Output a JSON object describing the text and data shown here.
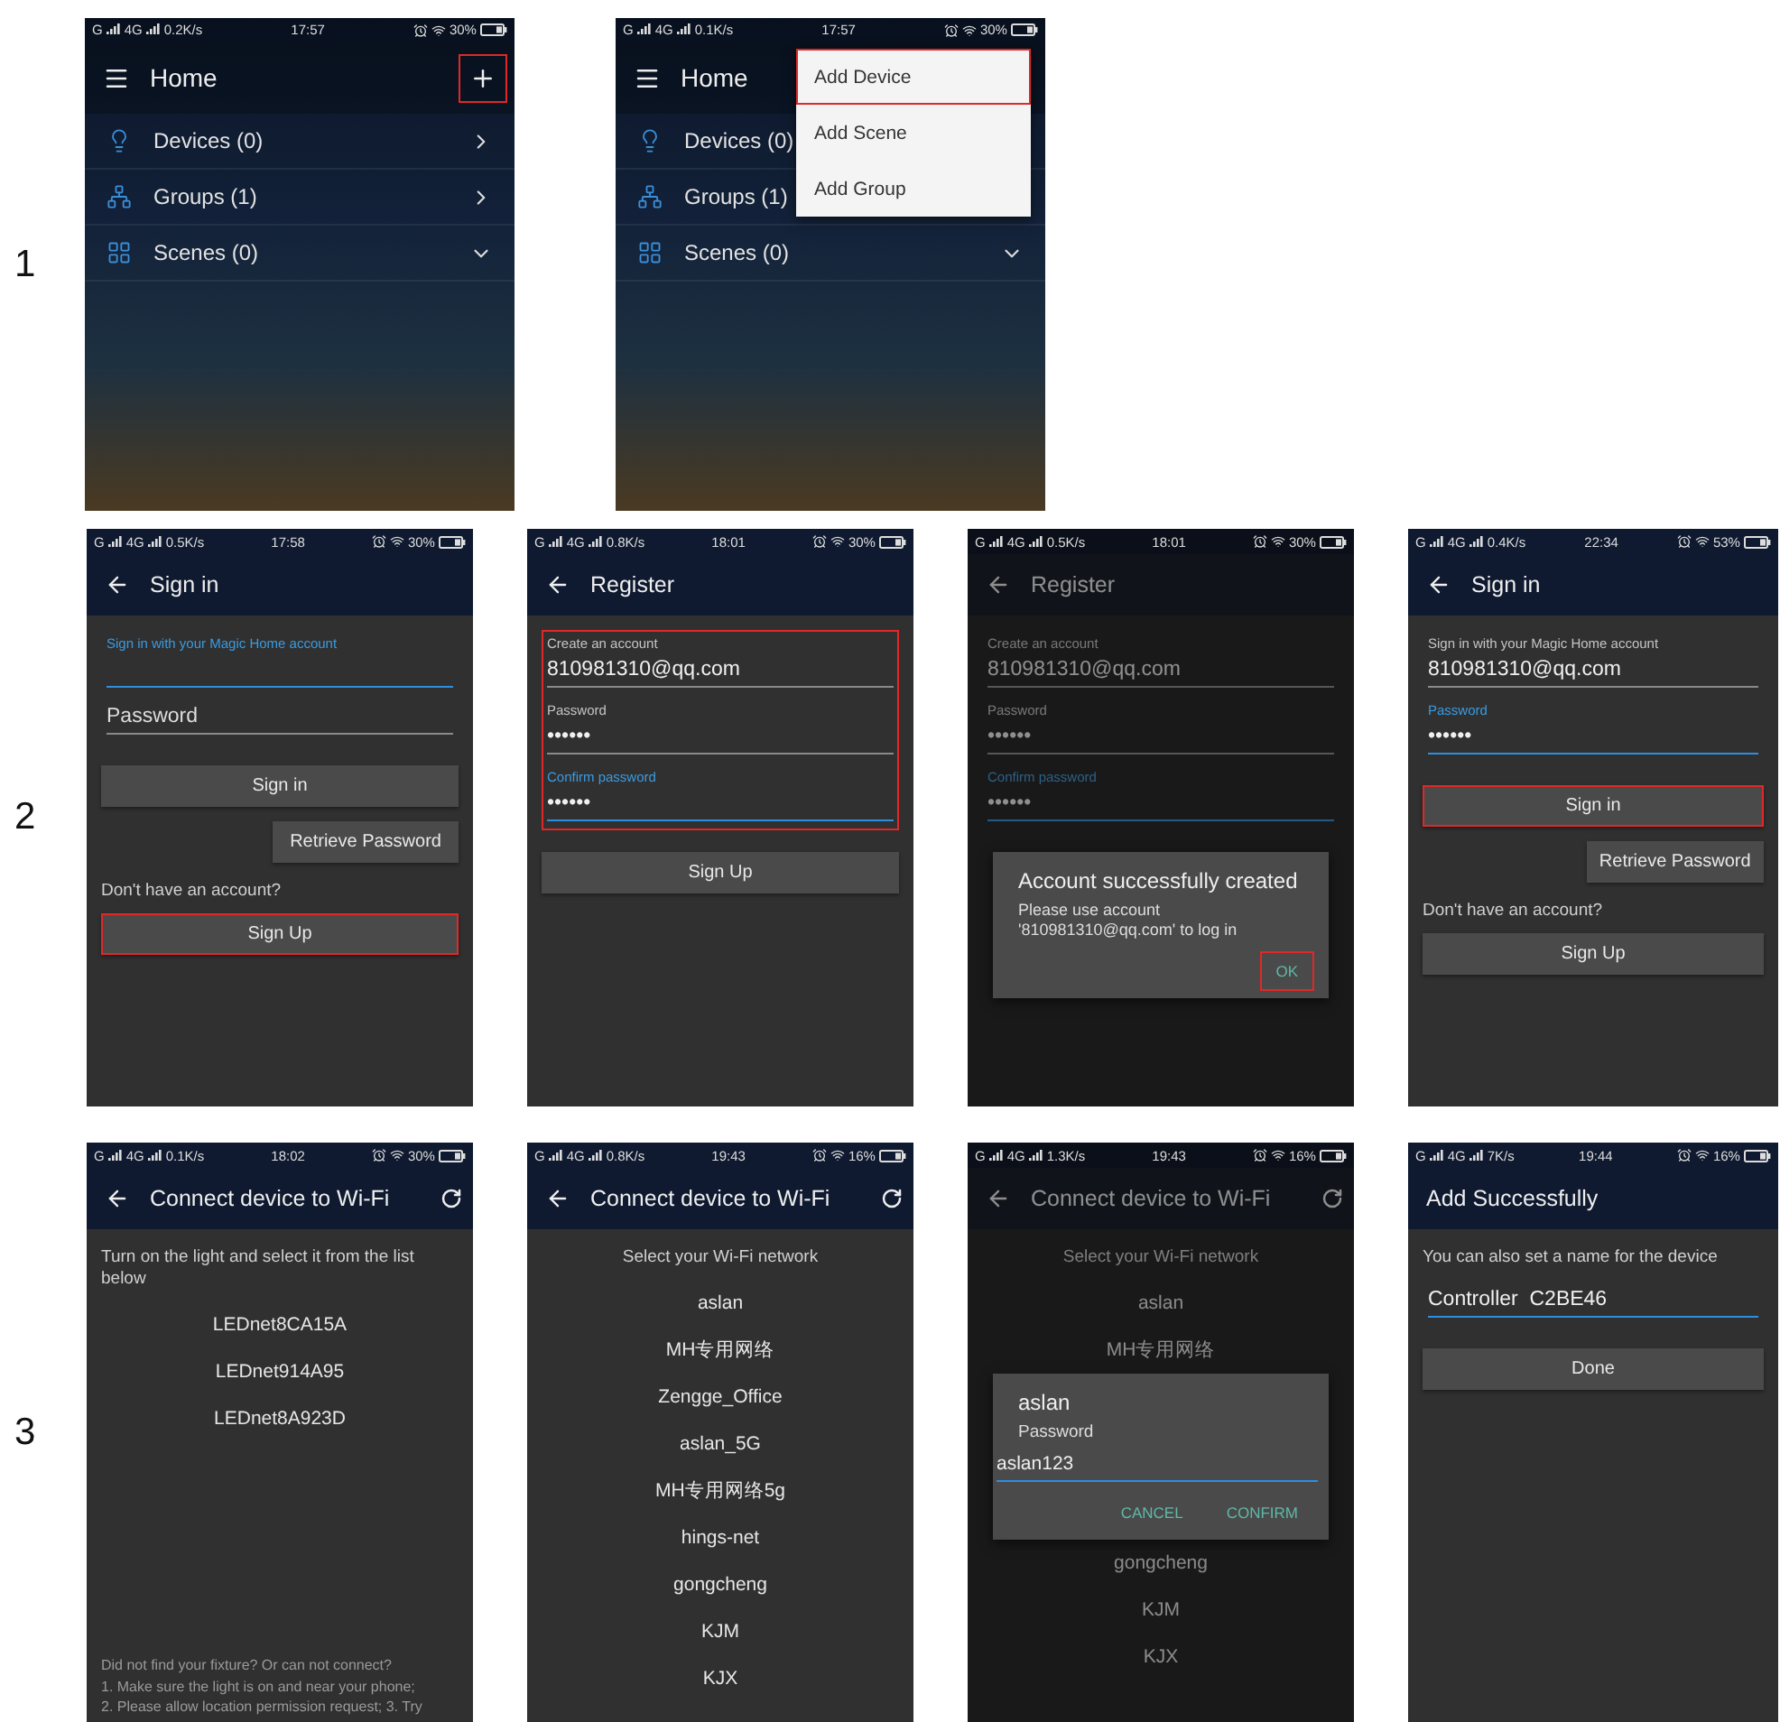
{
  "rows": [
    {
      "label": "1",
      "phones": [
        {
          "kind": "home",
          "dimmed": false,
          "status": {
            "net_1": "G",
            "net_2": "4G",
            "speed": "0.2K/s",
            "time": "17:57",
            "battery": "30%"
          },
          "header": {
            "kind": "menu",
            "title": "Home",
            "add_button": {
              "highlighted": true
            }
          },
          "body": [
            {
              "kind": "nav",
              "label": "Devices (0)",
              "expanded": false
            },
            {
              "kind": "nav",
              "label": "Groups (1)",
              "expanded": false
            },
            {
              "kind": "nav",
              "label": "Scenes (0)",
              "expanded": true
            }
          ]
        },
        {
          "kind": "home",
          "dimmed": false,
          "status": {
            "net_1": "G",
            "net_2": "4G",
            "speed": "0.1K/s",
            "time": "17:57",
            "battery": "30%"
          },
          "header": {
            "kind": "menu",
            "title": "Home"
          },
          "body": [
            {
              "kind": "nav",
              "label": "Devices (0)"
            },
            {
              "kind": "nav",
              "label": "Groups (1)"
            },
            {
              "kind": "nav",
              "label": "Scenes (0)",
              "expanded": true
            }
          ],
          "menu": {
            "items": [
              {
                "label": "Add Device",
                "highlighted": true
              },
              {
                "label": "Add Scene",
                "highlighted": false
              },
              {
                "label": "Add Group",
                "highlighted": false
              }
            ]
          }
        }
      ]
    },
    {
      "label": "2",
      "phones": [
        {
          "kind": "app",
          "dimmed": false,
          "status": {
            "net_1": "G",
            "net_2": "4G",
            "speed": "0.5K/s",
            "time": "17:58",
            "battery": "30%"
          },
          "header": {
            "kind": "back",
            "title": "Sign in"
          },
          "body": [
            {
              "kind": "fields",
              "highlighted": false,
              "fields": [
                {
                  "label": "Sign in with your Magic Home account",
                  "focused": true
                },
                {
                  "placeholder": "Password",
                  "focused": false
                }
              ]
            },
            {
              "kind": "button",
              "label": "Sign in",
              "highlighted": false
            },
            {
              "kind": "small-button",
              "label": "Retrieve Password",
              "highlighted": false
            },
            {
              "kind": "text",
              "text": "Don't have an account?"
            },
            {
              "kind": "button",
              "label": "Sign Up",
              "highlighted": true
            }
          ]
        },
        {
          "kind": "app",
          "dimmed": false,
          "status": {
            "net_1": "G",
            "net_2": "4G",
            "speed": "0.8K/s",
            "time": "18:01",
            "battery": "30%"
          },
          "header": {
            "kind": "back",
            "title": "Register"
          },
          "body": [
            {
              "kind": "fields",
              "highlighted": true,
              "fields": [
                {
                  "label": "Create an account",
                  "value": "810981310@qq.com",
                  "focused": false
                },
                {
                  "label": "Password",
                  "value": "••••••",
                  "focused": false
                },
                {
                  "label": "Confirm password",
                  "value": "••••••",
                  "focused": true
                }
              ]
            },
            {
              "kind": "button",
              "label": "Sign Up",
              "highlighted": false
            }
          ]
        },
        {
          "kind": "app",
          "dimmed": true,
          "status": {
            "net_1": "G",
            "net_2": "4G",
            "speed": "0.5K/s",
            "time": "18:01",
            "battery": "30%"
          },
          "header": {
            "kind": "back",
            "title": "Register"
          },
          "body": [
            {
              "kind": "fields",
              "highlighted": false,
              "fields": [
                {
                  "label": "Create an account",
                  "value": "810981310@qq.com",
                  "focused": false
                },
                {
                  "label": "Password",
                  "value": "••••••",
                  "focused": false
                },
                {
                  "label": "Confirm password",
                  "value": "••••••",
                  "focused": true
                }
              ]
            },
            {
              "kind": "dialog",
              "title": "Account successfully created",
              "message": "Please use account '810981310@qq.com' to log in",
              "buttons": [
                {
                  "label": "OK",
                  "highlighted": true
                }
              ]
            }
          ]
        },
        {
          "kind": "app",
          "dimmed": false,
          "status": {
            "net_1": "G",
            "net_2": "4G",
            "speed": "0.4K/s",
            "time": "22:34",
            "battery": "53%"
          },
          "header": {
            "kind": "back",
            "title": "Sign in"
          },
          "body": [
            {
              "kind": "fields",
              "highlighted": false,
              "fields": [
                {
                  "label": "Sign in with your Magic Home account",
                  "value": "810981310@qq.com",
                  "focused": false
                },
                {
                  "label": "Password",
                  "value": "••••••",
                  "focused": true
                }
              ]
            },
            {
              "kind": "button",
              "label": "Sign in",
              "highlighted": true
            },
            {
              "kind": "small-button",
              "label": "Retrieve Password",
              "highlighted": false
            },
            {
              "kind": "text",
              "text": "Don't have an account?"
            },
            {
              "kind": "button",
              "label": "Sign Up",
              "highlighted": false
            }
          ]
        }
      ]
    },
    {
      "label": "3",
      "phones": [
        {
          "kind": "app",
          "dimmed": false,
          "status": {
            "net_1": "G",
            "net_2": "4G",
            "speed": "0.1K/s",
            "time": "18:02",
            "battery": "30%"
          },
          "header": {
            "kind": "back",
            "title": "Connect device to Wi-Fi",
            "refresh_button": {
              "highlighted": false
            }
          },
          "body": [
            {
              "kind": "text",
              "text": "Turn on the light and select it from the list below"
            },
            {
              "kind": "item",
              "label": "LEDnet8CA15A"
            },
            {
              "kind": "item",
              "label": "LEDnet914A95"
            },
            {
              "kind": "item",
              "label": "LEDnet8A923D"
            },
            {
              "kind": "note",
              "text": "Did not find your fixture? Or can not connect?\n1. Make sure the light is on and near your phone;\n2. Please allow location permission request; 3. Try"
            }
          ]
        },
        {
          "kind": "app",
          "dimmed": false,
          "status": {
            "net_1": "G",
            "net_2": "4G",
            "speed": "0.8K/s",
            "time": "19:43",
            "battery": "16%"
          },
          "header": {
            "kind": "back",
            "title": "Connect device to Wi-Fi",
            "refresh_button": {
              "highlighted": false
            }
          },
          "body": [
            {
              "kind": "caption",
              "text": "Select your Wi-Fi network"
            },
            {
              "kind": "item",
              "label": "aslan"
            },
            {
              "kind": "item",
              "label": "MH专用网络"
            },
            {
              "kind": "item",
              "label": "Zengge_Office"
            },
            {
              "kind": "item",
              "label": "aslan_5G"
            },
            {
              "kind": "item",
              "label": "MH专用网络5g"
            },
            {
              "kind": "item",
              "label": "hings-net"
            },
            {
              "kind": "item",
              "label": "gongcheng"
            },
            {
              "kind": "item",
              "label": "KJM"
            },
            {
              "kind": "item",
              "label": "KJX"
            }
          ]
        },
        {
          "kind": "app",
          "dimmed": true,
          "status": {
            "net_1": "G",
            "net_2": "4G",
            "speed": "1.3K/s",
            "time": "19:43",
            "battery": "16%"
          },
          "header": {
            "kind": "back",
            "title": "Connect device to Wi-Fi",
            "refresh_button": {
              "highlighted": false
            }
          },
          "body": [
            {
              "kind": "caption",
              "text": "Select your Wi-Fi network"
            },
            {
              "kind": "item",
              "label": "aslan"
            },
            {
              "kind": "item",
              "label": "MH专用网络"
            },
            {
              "kind": "dialog",
              "title": "aslan",
              "prompt": "Password",
              "input": "aslan123",
              "buttons": [
                {
                  "label": "CANCEL",
                  "highlighted": false
                },
                {
                  "label": "CONFIRM",
                  "highlighted": false
                }
              ]
            },
            {
              "kind": "item",
              "label": "gongcheng"
            },
            {
              "kind": "item",
              "label": "KJM"
            },
            {
              "kind": "item",
              "label": "KJX"
            }
          ]
        },
        {
          "kind": "app",
          "dimmed": false,
          "status": {
            "net_1": "G",
            "net_2": "4G",
            "speed": "7K/s",
            "time": "19:44",
            "battery": "16%"
          },
          "header": {
            "kind": "plain",
            "title": "Add Successfully"
          },
          "body": [
            {
              "kind": "text",
              "text": "You can also set a name for the device"
            },
            {
              "kind": "fields",
              "highlighted": false,
              "fields": [
                {
                  "value": "Controller  C2BE46",
                  "focused": true
                }
              ]
            },
            {
              "kind": "button",
              "label": "Done",
              "highlighted": false
            }
          ]
        }
      ]
    }
  ]
}
